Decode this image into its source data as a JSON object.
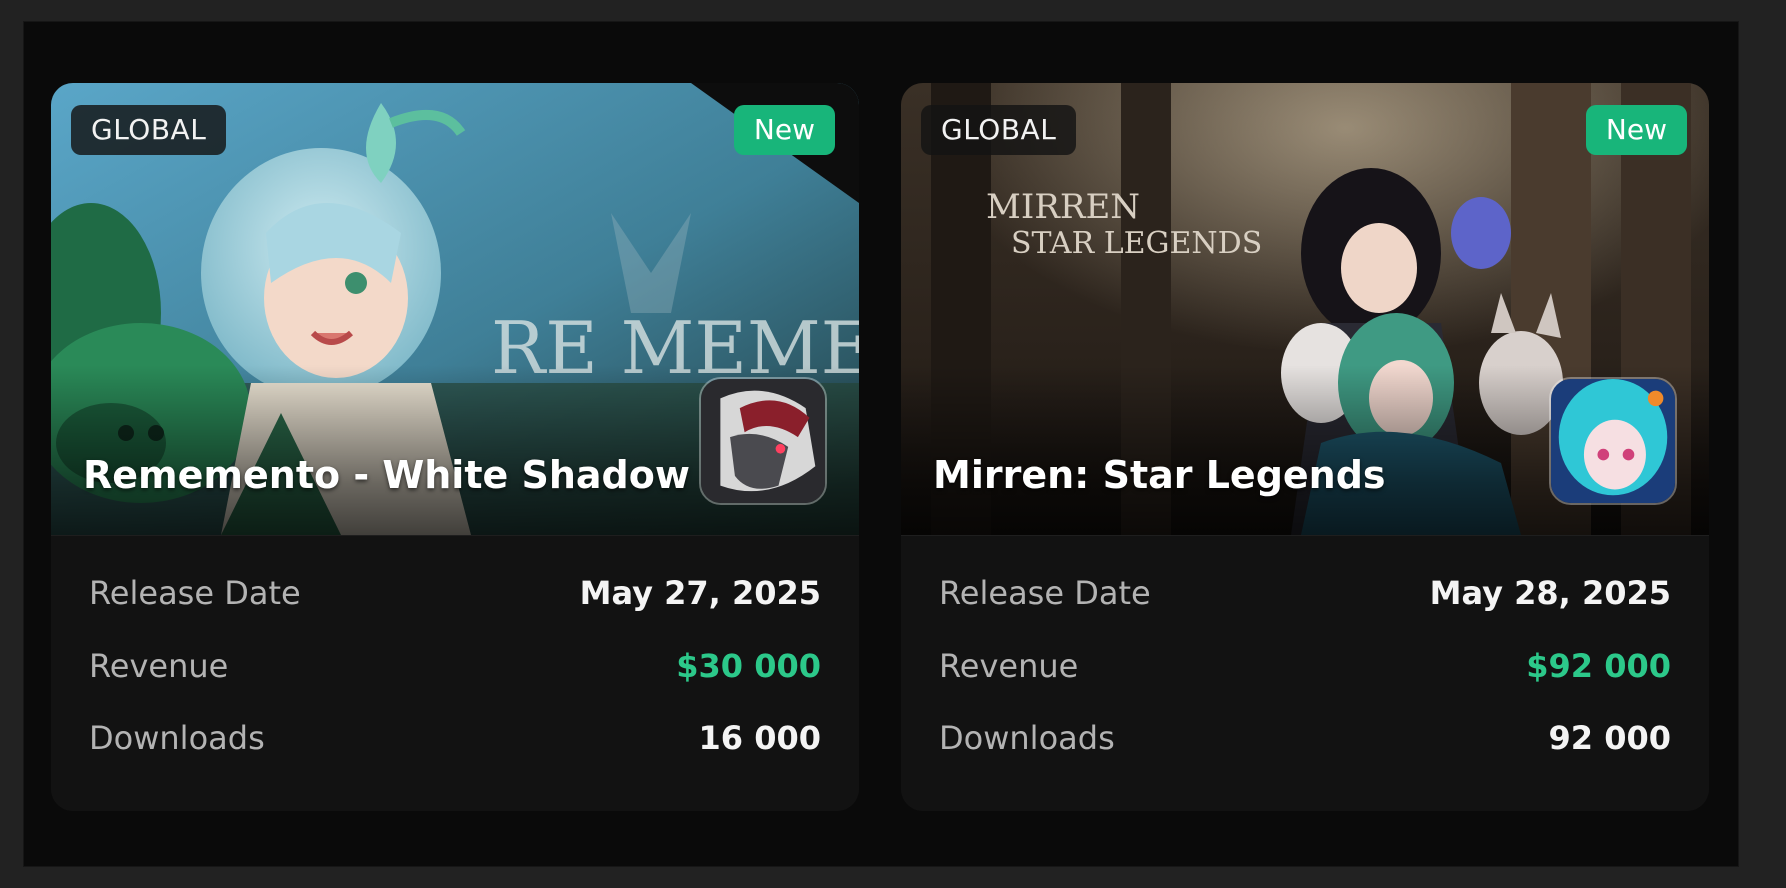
{
  "cards": [
    {
      "region": "GLOBAL",
      "badge": "New",
      "title": "Rememento - White Shadow",
      "art_logo": "RE MEMENTO",
      "stats": {
        "release_label": "Release Date",
        "release_value": "May 27, 2025",
        "revenue_label": "Revenue",
        "revenue_value": "$30 000",
        "downloads_label": "Downloads",
        "downloads_value": "16 000"
      },
      "icon": "game-app-icon"
    },
    {
      "region": "GLOBAL",
      "badge": "New",
      "title": "Mirren: Star Legends",
      "art_logo_line1": "MIRREN",
      "art_logo_line2": "STAR LEGENDS",
      "stats": {
        "release_label": "Release Date",
        "release_value": "May 28, 2025",
        "revenue_label": "Revenue",
        "revenue_value": "$92 000",
        "downloads_label": "Downloads",
        "downloads_value": "92 000"
      },
      "icon": "game-app-icon"
    }
  ],
  "colors": {
    "new_badge": "#18b57a",
    "revenue": "#2cc88a",
    "panel": "#0a0a0a",
    "card": "#121212"
  }
}
